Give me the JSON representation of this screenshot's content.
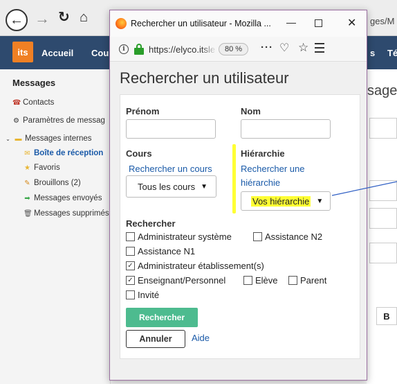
{
  "background": {
    "url_tail": "ges/M",
    "header": {
      "logo": "its",
      "nav_home": "Accueil",
      "nav_courses": "Cou",
      "nav_s": "s",
      "nav_te": "Té"
    },
    "sidebar": {
      "heading": "Messages",
      "items": [
        {
          "label": "Contacts",
          "icon": "contacts-icon"
        },
        {
          "label": "Paramètres de messag",
          "icon": "gear-icon"
        },
        {
          "label": "Messages internes",
          "icon": "folder-icon"
        },
        {
          "label": "Boîte de réception",
          "icon": "inbox-icon",
          "active": true
        },
        {
          "label": "Favoris",
          "icon": "star-icon"
        },
        {
          "label": "Brouillons (2)",
          "icon": "pencil-icon"
        },
        {
          "label": "Messages envoyés",
          "icon": "sent-arrow-icon"
        },
        {
          "label": "Messages supprimés",
          "icon": "trash-icon"
        }
      ]
    },
    "right_title": "sage",
    "bold_button": "B"
  },
  "popup": {
    "window_title": "Rechercher un utilisateur - Mozilla ...",
    "url": "https://elyco.itslea",
    "zoom": "80 %",
    "page_title": "Rechercher un utilisateur",
    "form": {
      "firstname_label": "Prénom",
      "lastname_label": "Nom",
      "course_label": "Cours",
      "course_link": "Rechercher un cours",
      "course_select": "Tous les cours",
      "hierarchy_label": "Hiérarchie",
      "hierarchy_link_1": "Rechercher une",
      "hierarchy_link_2": "hiérarchie",
      "hierarchy_select": "Vos hiérarchie",
      "search_section_label": "Rechercher",
      "checkboxes": [
        {
          "label": "Administrateur système",
          "checked": false
        },
        {
          "label": "Assistance N2",
          "checked": false
        },
        {
          "label": "Assistance N1",
          "checked": false
        },
        {
          "label": "Administrateur établissement(s)",
          "checked": true
        },
        {
          "label": "Enseignant/Personnel",
          "checked": true
        },
        {
          "label": "Elève",
          "checked": false
        },
        {
          "label": "Parent",
          "checked": false
        },
        {
          "label": "Invité",
          "checked": false
        }
      ],
      "search_button": "Rechercher",
      "cancel_button": "Annuler",
      "help_link": "Aide"
    },
    "colors": {
      "highlight": "#ffff33",
      "primary_button": "#4dbb8f",
      "link": "#1a5aa8",
      "window_border": "#9a6fa0"
    }
  }
}
